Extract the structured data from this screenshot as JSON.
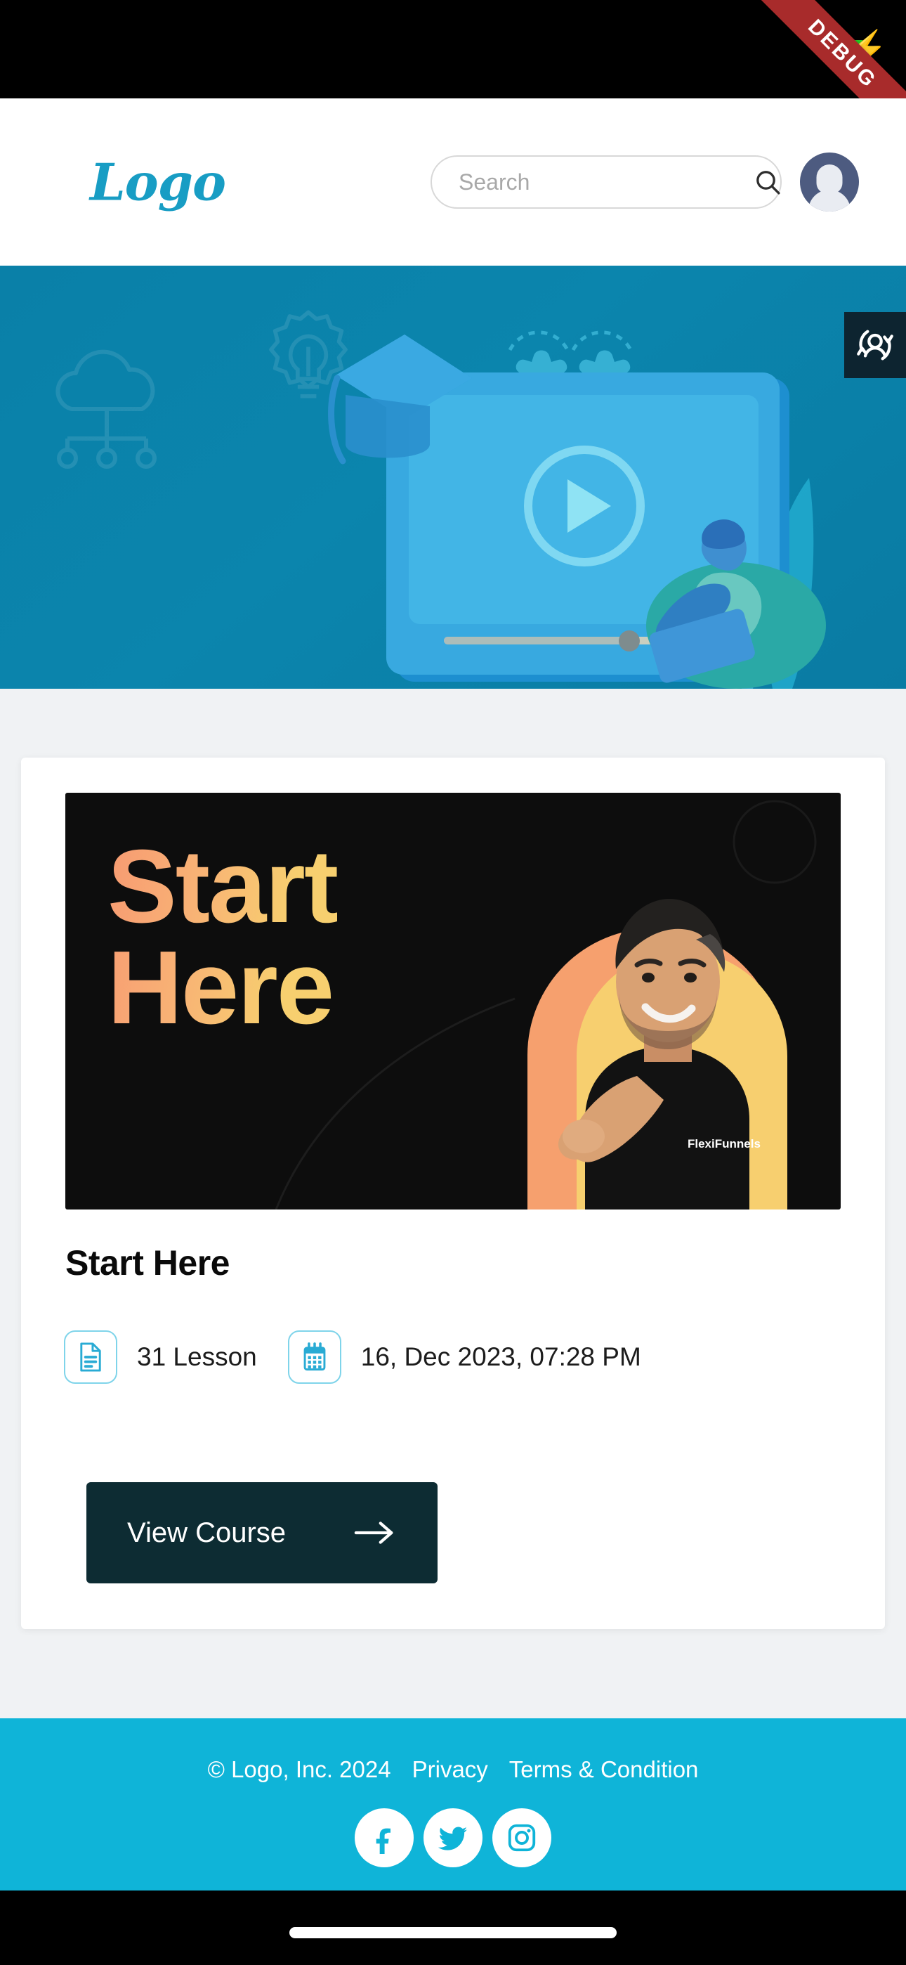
{
  "statusbar": {
    "debug_label": "DEBUG",
    "battery_icon": "battery-charging-icon"
  },
  "header": {
    "logo_text": "Logo",
    "search": {
      "placeholder": "Search",
      "value": "",
      "icon": "search-icon"
    },
    "avatar_icon": "user-avatar-icon"
  },
  "hero": {
    "illustration": "online-learning-illustration",
    "switch_account_icon": "switch-account-icon",
    "background_color": "#0b82aa",
    "deco_icons": [
      "cloud-network-icon",
      "lightbulb-gear-icon",
      "gears-icon"
    ]
  },
  "course_card": {
    "thumbnail": {
      "title_line1": "Start",
      "title_line2": "Here",
      "shirt_brand": "FlexiFunnels",
      "background_color": "#0d0d0d",
      "title_gradient_from": "#f79a72",
      "title_gradient_to": "#f7cf6f"
    },
    "title": "Start Here",
    "meta": [
      {
        "icon": "document-icon",
        "text": "31 Lesson"
      },
      {
        "icon": "calendar-icon",
        "text": "16, Dec 2023, 07:28 PM"
      }
    ],
    "button": {
      "label": "View Course",
      "icon": "arrow-right-icon",
      "background_color": "#0d2c33"
    }
  },
  "footer": {
    "copyright": "© Logo, Inc. 2024",
    "links": [
      "Privacy",
      "Terms & Condition"
    ],
    "background_color": "#0fb4d8",
    "socials": [
      "facebook-icon",
      "twitter-icon",
      "instagram-icon"
    ]
  }
}
